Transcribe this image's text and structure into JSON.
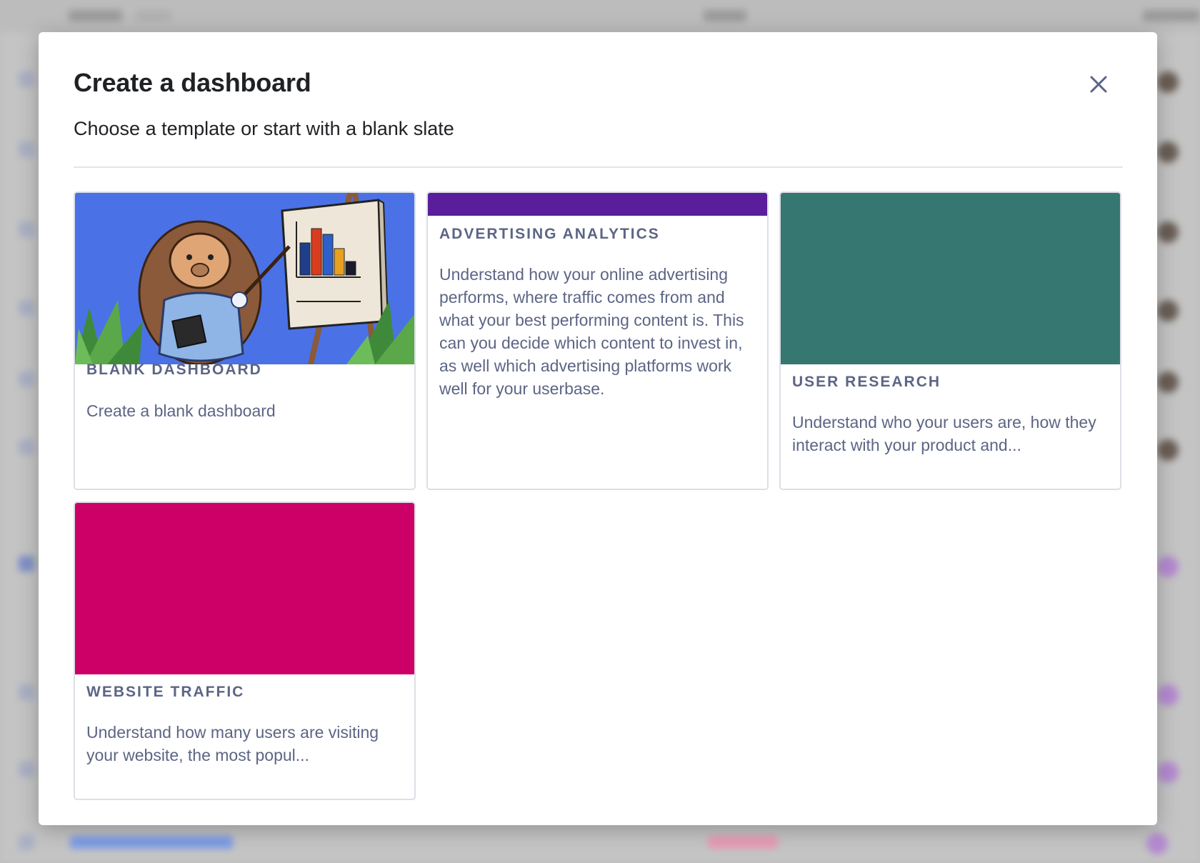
{
  "modal": {
    "title": "Create a dashboard",
    "subtitle": "Choose a template or start with a blank slate"
  },
  "templates": [
    {
      "title": "BLANK DASHBOARD",
      "description": "Create a blank dashboard",
      "cover": "illustration",
      "cover_icon": "hedgehog-presenting-chart-illustration",
      "color": "#4a72e6"
    },
    {
      "title": "ADVERTISING ANALYTICS",
      "description": "Understand how your online advertising performs, where traffic comes from and what your best performing content is. This can you decide which content to invest in, as well which advertising platforms work well for your userbase.",
      "color": "#5a1d9c"
    },
    {
      "title": "USER RESEARCH",
      "description": "Understand who your users are, how they interact with your product and...",
      "color": "#367772"
    },
    {
      "title": "WEBSITE TRAFFIC",
      "description": "Understand how many users are visiting your website, the most popul...",
      "color": "#cc0066"
    }
  ],
  "icons": {
    "close": "close-icon"
  },
  "colors": {
    "title_text": "#1f2125",
    "card_text": "#5c6585",
    "card_border": "#dcdfe6"
  }
}
